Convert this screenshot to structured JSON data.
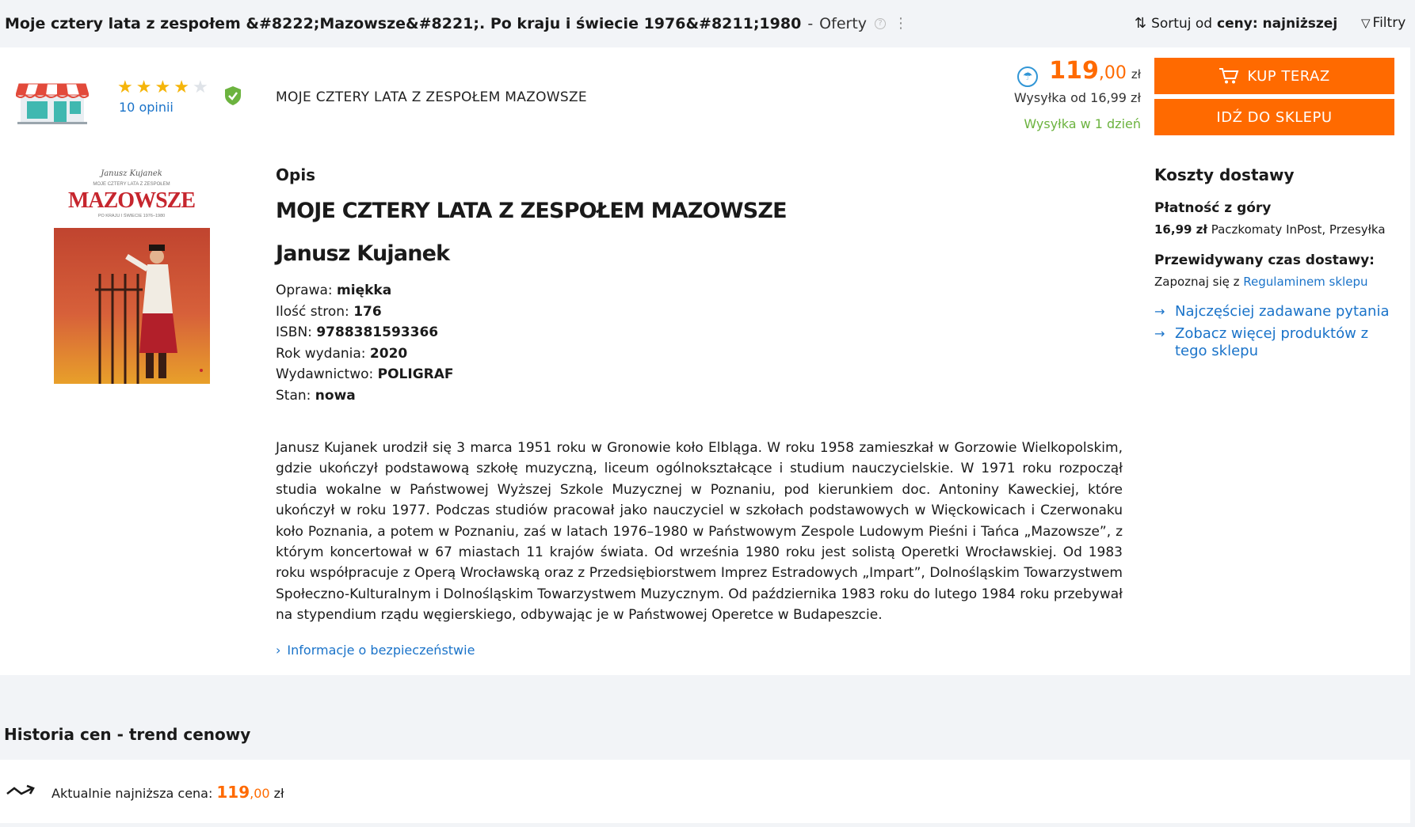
{
  "header": {
    "title": "Moje cztery lata z zespołem &#8222;Mazowsze&#8221;. Po kraju i świecie 1976&#8211;1980",
    "separator": "-",
    "offers_label": "Oferty",
    "help_glyph": "?",
    "sort_prefix": "Sortuj od",
    "sort_value": "ceny: najniższej",
    "filters_label": "Filtry"
  },
  "offer": {
    "rating_stars": 4,
    "rating_max": 5,
    "reviews_label": "10 opinii",
    "product_name": "MOJE CZTERY LATA Z ZESPOŁEM MAZOWSZE",
    "price_int": "119",
    "price_dec": ",00",
    "currency": "zł",
    "shipping_from": "Wysyłka od 16,99 zł",
    "shipping_time": "Wysyłka w 1 dzień",
    "buy_label": "KUP TERAZ",
    "shop_label": "IDŹ DO SKLEPU"
  },
  "cover": {
    "author_script": "Janusz Kujanek",
    "subtitle": "MOJE CZTERY LATA Z ZESPOŁEM",
    "title": "MAZOWSZE",
    "tagline": "PO KRAJU I ŚWIECIE 1976–1980"
  },
  "description": {
    "heading": "Opis",
    "book_title": "MOJE CZTERY LATA Z ZESPOŁEM MAZOWSZE",
    "author": "Janusz Kujanek",
    "specs": [
      {
        "label": "Oprawa: ",
        "value": "miękka"
      },
      {
        "label": "Ilość stron: ",
        "value": "176"
      },
      {
        "label": "ISBN: ",
        "value": "9788381593366"
      },
      {
        "label": "Rok wydania: ",
        "value": "2020"
      },
      {
        "label": "Wydawnictwo: ",
        "value": "POLIGRAF"
      },
      {
        "label": "Stan: ",
        "value": "nowa"
      }
    ],
    "bio": "Janusz Kujanek urodził się 3 marca 1951 roku w Gronowie koło Elbląga. W roku 1958 zamieszkał w Gorzowie Wielkopolskim, gdzie ukończył podstawową szkołę muzyczną, liceum ogólnokształcące i studium nauczycielskie. W 1971 roku rozpoczął studia wokalne w Państwowej Wyższej Szkole Muzycznej w Poznaniu, pod kierunkiem doc. Antoniny Kaweckiej, które ukończył w roku 1977. Podczas studiów pracował jako nauczyciel w szkołach podstawowych w Więckowicach i Czerwonaku koło Poznania, a potem w Poznaniu, zaś w latach 1976–1980 w Państwowym Zespole Ludowym Pieśni i Tańca „Mazowsze”, z którym koncertował w 67 miastach 11 krajów świata. Od września 1980 roku jest solistą Operetki Wrocławskiej. Od 1983 roku współpracuje z Operą Wrocławską oraz z Przedsiębiorstwem Imprez Estradowych „Impart”, Dolnośląskim Towarzystwem Społeczno-Kulturalnym i Dolnośląskim Towarzystwem Muzycznym. Od października 1983 roku do lutego 1984 roku przebywał na stypendium rządu węgierskiego, odbywając je w Państwowej Operetce w Budapeszcie.",
    "safety_link": "Informacje o bezpieczeństwie"
  },
  "delivery": {
    "heading": "Koszty dostawy",
    "prepay_heading": "Płatność z góry",
    "prepay_price": "16,99 zł",
    "prepay_methods": " Paczkomaty InPost, Przesyłka",
    "eta_heading": "Przewidywany czas dostawy:",
    "eta_prefix": "Zapoznaj się z ",
    "eta_link": "Regulaminem sklepu",
    "faq_link": "Najczęściej zadawane pytania",
    "more_link": "Zobacz więcej produktów z tego sklepu"
  },
  "history": {
    "heading": "Historia cen - trend cenowy",
    "current_label": "Aktualnie najniższa cena:",
    "price_int": "119",
    "price_dec": ",00",
    "currency": "zł"
  },
  "colors": {
    "accent": "#ff6a00",
    "link": "#1a73c9",
    "star": "#f5b50a",
    "success": "#6cb33f"
  }
}
